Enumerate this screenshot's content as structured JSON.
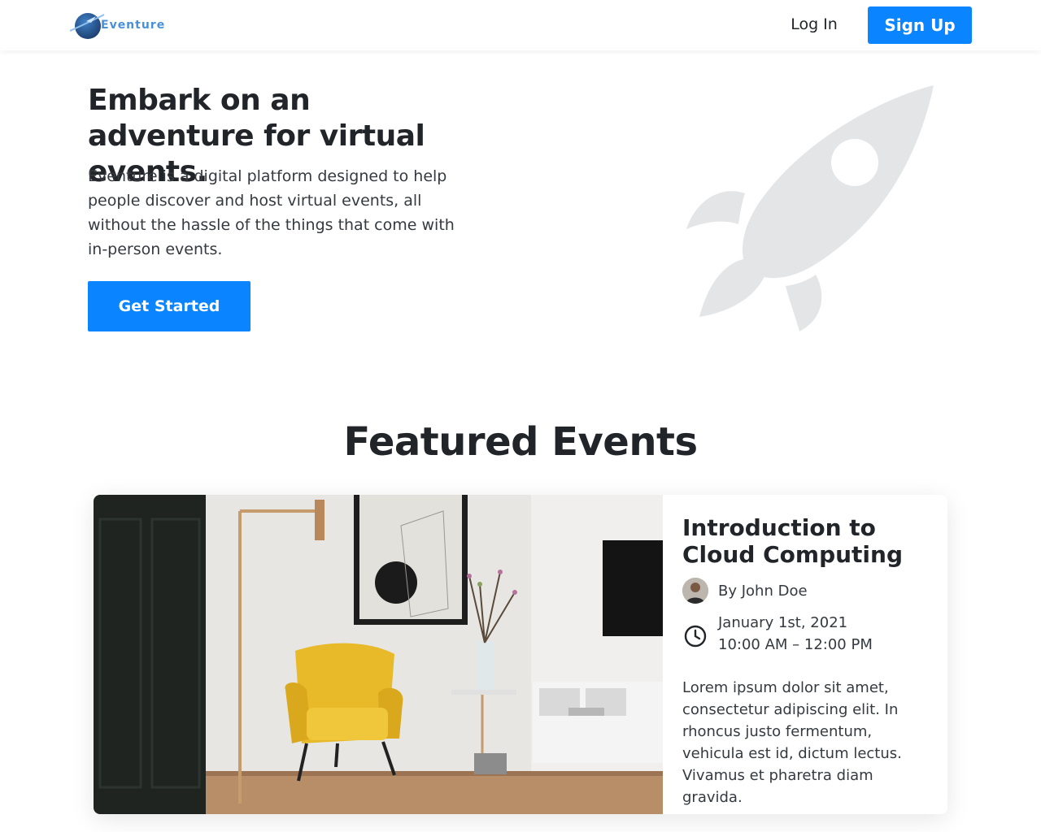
{
  "header": {
    "logo_text": "Eventure",
    "login_label": "Log In",
    "signup_label": "Sign Up"
  },
  "hero": {
    "title": "Embark on an adventure for virtual events.",
    "description": "Eventure is a digital platform designed to help people discover and host virtual events, all without the hassle of the things that come with in-person events.",
    "cta_label": "Get Started",
    "illustration_icon": "rocket-icon"
  },
  "featured": {
    "title": "Featured Events",
    "events": [
      {
        "title": "Introduction to Cloud Computing",
        "author": "By John Doe",
        "date": "January 1st, 2021",
        "time": "10:00 AM – 12:00 PM",
        "description": "Lorem ipsum dolor sit amet, consectetur adipiscing elit. In rhoncus justo fermentum, vehicula est id, dictum lectus. Vivamus et pharetra diam gravida."
      }
    ]
  },
  "colors": {
    "accent": "#0a84ff",
    "text": "#212529",
    "rocket": "#e4e5e6"
  }
}
